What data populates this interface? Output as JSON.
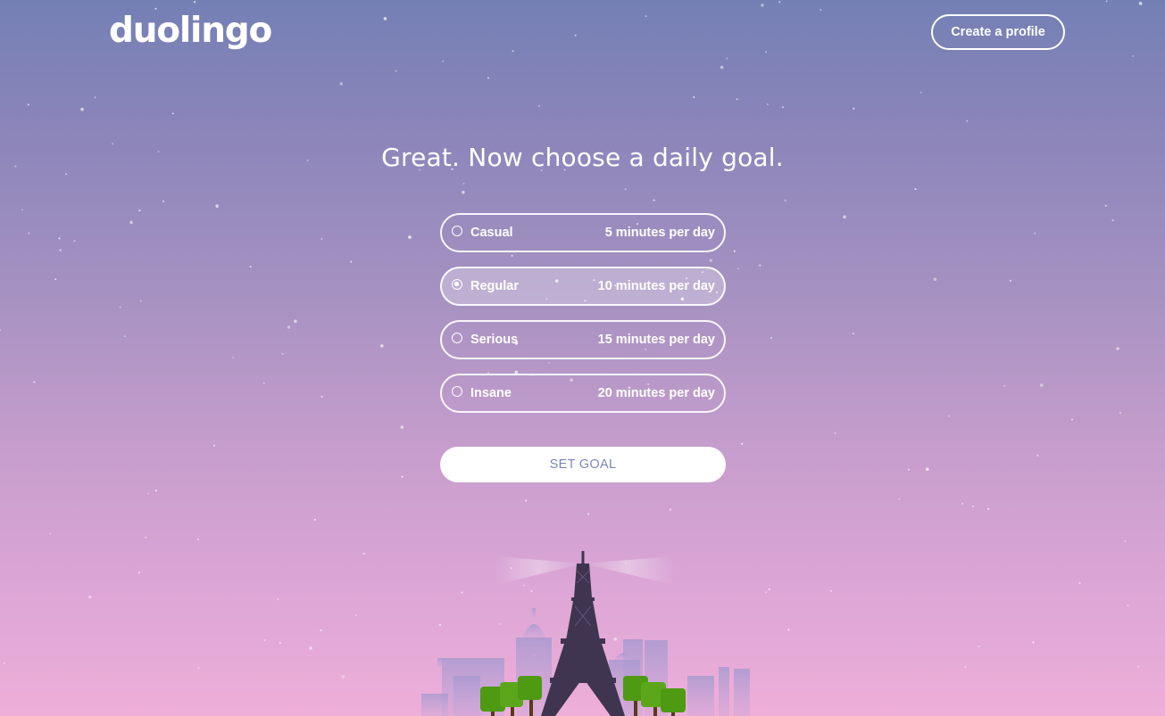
{
  "header": {
    "logo_text": "duolingo",
    "create_profile_label": "Create a profile"
  },
  "main": {
    "heading": "Great. Now choose a daily goal.",
    "goals": [
      {
        "label": "Casual",
        "time": "5 minutes per day",
        "selected": false
      },
      {
        "label": "Regular",
        "time": "10 minutes per day",
        "selected": true
      },
      {
        "label": "Serious",
        "time": "15 minutes per day",
        "selected": false
      },
      {
        "label": "Insane",
        "time": "20 minutes per day",
        "selected": false
      }
    ],
    "set_goal_label": "SET GOAL"
  },
  "colors": {
    "sky_top": "#7480b4",
    "sky_bottom": "#eeaed8",
    "button_text": "#7d86b5",
    "tower": "#3f3550",
    "trees": "#4e9a12"
  },
  "illustration": {
    "icon": "paris-skyline-eiffel-tower-illustration"
  }
}
